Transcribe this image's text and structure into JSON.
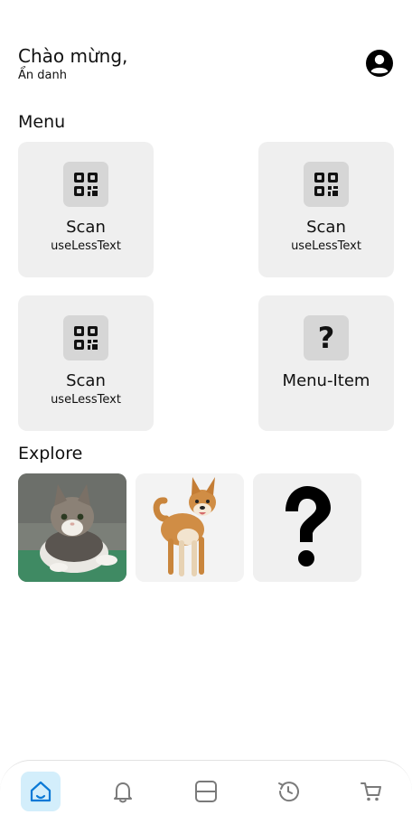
{
  "header": {
    "greeting": "Chào mừng,",
    "username": "Ẩn danh",
    "avatar_icon": "account-circle-icon"
  },
  "menu": {
    "title": "Menu",
    "items": [
      {
        "title": "Scan",
        "subtitle": "useLessText",
        "icon": "qr-code-icon"
      },
      {
        "title": "Scan",
        "subtitle": "useLessText",
        "icon": "qr-code-icon"
      },
      {
        "title": "Scan",
        "subtitle": "useLessText",
        "icon": "qr-code-icon"
      },
      {
        "title": "Menu-Item",
        "subtitle": "",
        "icon": "question-icon"
      }
    ]
  },
  "explore": {
    "title": "Explore",
    "items": [
      {
        "image": "cat-photo"
      },
      {
        "image": "dog-photo"
      },
      {
        "image": "question-mark"
      }
    ]
  },
  "bottom_nav": {
    "active_color": "#d3eefb",
    "items": [
      {
        "icon": "home-icon",
        "active": true
      },
      {
        "icon": "bell-icon",
        "active": false
      },
      {
        "icon": "scan-frame-icon",
        "active": false
      },
      {
        "icon": "history-icon",
        "active": false
      },
      {
        "icon": "cart-icon",
        "active": false
      }
    ]
  }
}
